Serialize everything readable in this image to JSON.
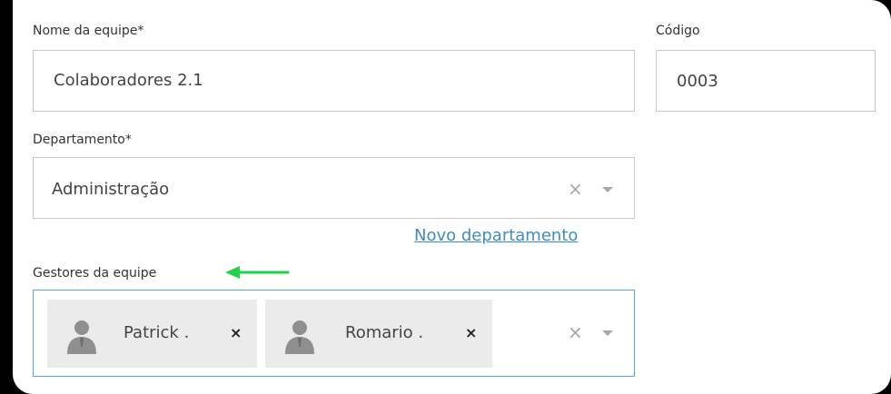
{
  "form": {
    "team_name": {
      "label": "Nome da equipe*",
      "value": "Colaboradores 2.1"
    },
    "code": {
      "label": "Código",
      "value": "0003"
    },
    "department": {
      "label": "Departamento*",
      "value": "Administração",
      "clear_glyph": "×",
      "new_link": "Novo departamento"
    },
    "managers": {
      "label": "Gestores da equipe",
      "clear_glyph": "×",
      "remove_glyph": "×",
      "items": [
        {
          "name": "Patrick ."
        },
        {
          "name": "Romario ."
        }
      ]
    }
  },
  "icons": {
    "avatar": "person-avatar-icon",
    "arrow": "left-arrow-icon",
    "caret": "chevron-down-icon",
    "clear": "close-icon"
  },
  "colors": {
    "focus_border": "#5ba7d6",
    "link": "#3d8cc1",
    "annotation_arrow": "#22d34a",
    "chip_bg": "#ebebeb"
  }
}
